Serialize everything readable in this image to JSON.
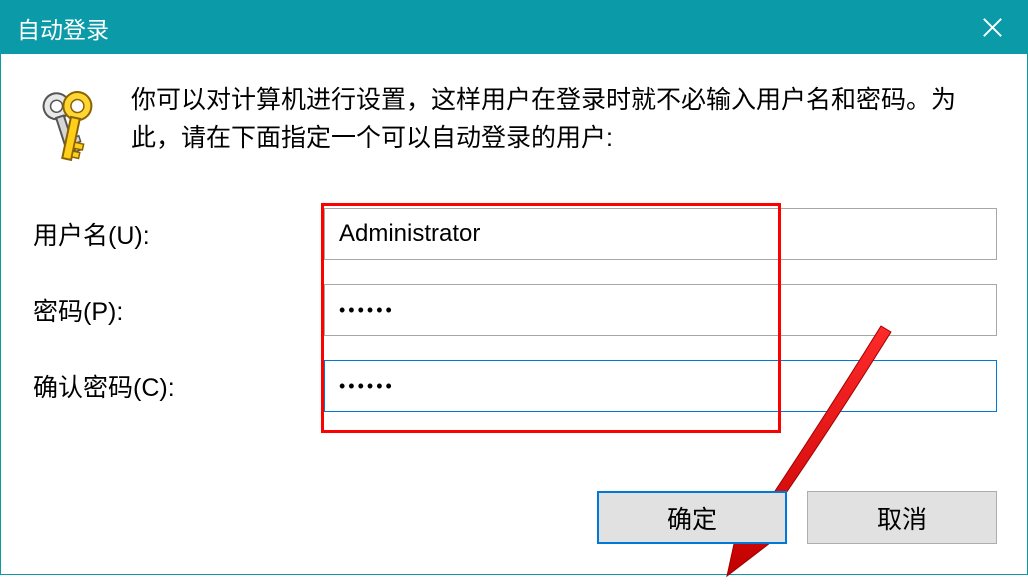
{
  "title": "自动登录",
  "intro": "你可以对计算机进行设置，这样用户在登录时就不必输入用户名和密码。为此，请在下面指定一个可以自动登录的用户:",
  "labels": {
    "username": "用户名(U):",
    "password": "密码(P):",
    "confirm": "确认密码(C):"
  },
  "values": {
    "username": "Administrator",
    "password": "••••••",
    "confirm": "••••••"
  },
  "buttons": {
    "ok": "确定",
    "cancel": "取消"
  }
}
